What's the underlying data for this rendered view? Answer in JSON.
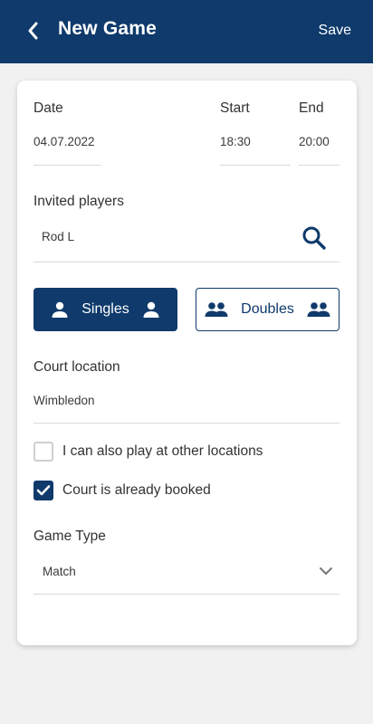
{
  "header": {
    "title": "New Game",
    "save_label": "Save",
    "back_icon": "chevron-left-icon",
    "background_color": "#0f3a6b"
  },
  "form": {
    "date": {
      "label": "Date",
      "value": "04.07.2022"
    },
    "start": {
      "label": "Start",
      "value": "18:30"
    },
    "end": {
      "label": "End",
      "value": "20:00"
    },
    "invited_players": {
      "label": "Invited players",
      "value": "Rod L",
      "icon": "search-icon"
    },
    "mode": {
      "options": [
        {
          "label": "Singles",
          "icon": "person-icon",
          "selected": true
        },
        {
          "label": "Doubles",
          "icon": "people-icon",
          "selected": false
        }
      ]
    },
    "court_location": {
      "label": "Court location",
      "value": "Wimbledon"
    },
    "checkboxes": [
      {
        "label": "I can also play at other locations",
        "checked": false
      },
      {
        "label": "Court is already booked",
        "checked": true
      }
    ],
    "game_type": {
      "label": "Game Type",
      "selected": "Match",
      "icon": "chevron-down-icon"
    }
  }
}
